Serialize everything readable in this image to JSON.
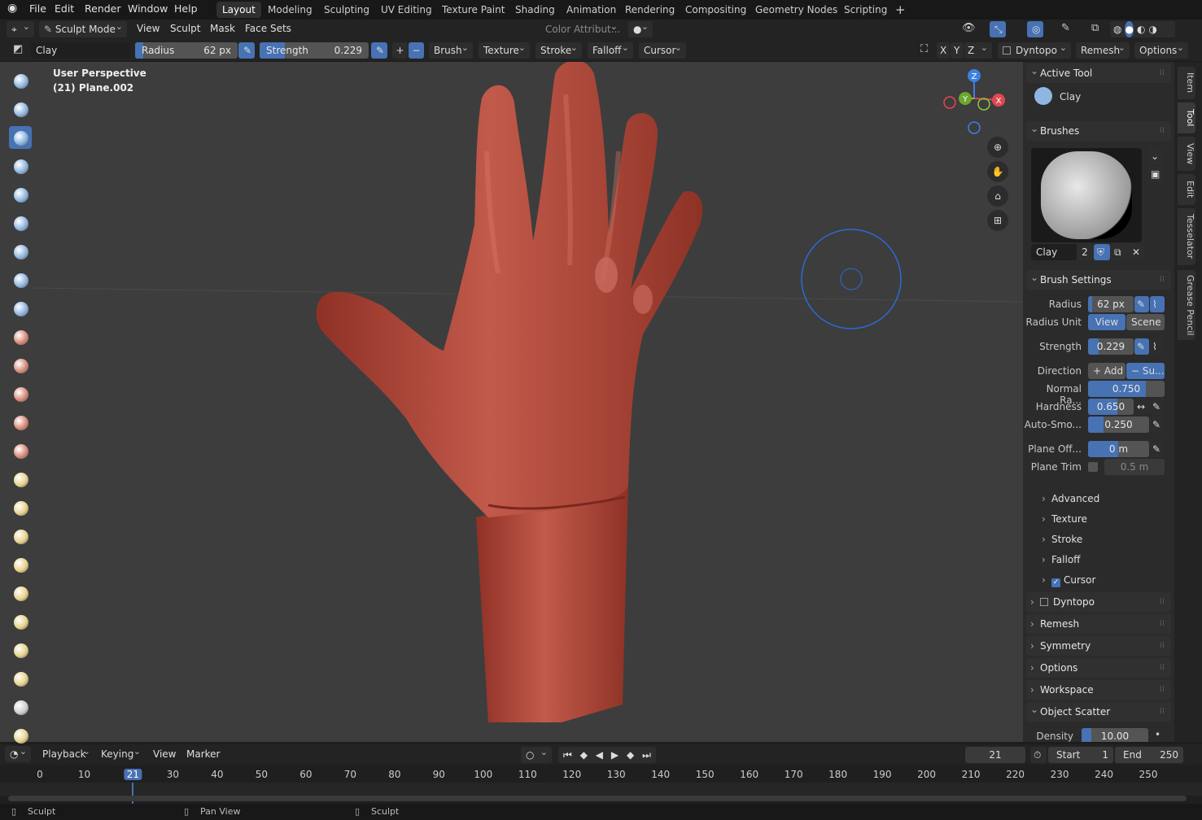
{
  "app": {
    "menus": [
      "File",
      "Edit",
      "Render",
      "Window",
      "Help"
    ],
    "workspaces": [
      "Layout",
      "Modeling",
      "Sculpting",
      "UV Editing",
      "Texture Paint",
      "Shading",
      "Animation",
      "Rendering",
      "Compositing",
      "Geometry Nodes",
      "Scripting"
    ],
    "active_workspace": "Layout",
    "add_tab": "+"
  },
  "header": {
    "mode": "Sculpt Mode",
    "menus": [
      "View",
      "Sculpt",
      "Mask",
      "Face Sets"
    ],
    "color_attr": "Color Attribut...",
    "axes": [
      "X",
      "Y",
      "Z"
    ],
    "dyntopo": "Dyntopo",
    "remesh": "Remesh",
    "options": "Options"
  },
  "tool_header": {
    "brush_name": "Clay",
    "radius_label": "Radius",
    "radius_value": "62 px",
    "strength_label": "Strength",
    "strength_value": "0.229",
    "strength_fraction": 0.229,
    "menus": [
      "Brush",
      "Texture",
      "Stroke",
      "Falloff",
      "Cursor"
    ],
    "plus": "+",
    "minus": "−"
  },
  "viewport": {
    "perspective": "User Perspective",
    "object": "(21) Plane.002",
    "gizmo": {
      "z": "Z",
      "y": "Y",
      "x": "X"
    }
  },
  "npanel": {
    "active_tool": {
      "title": "Active Tool",
      "name": "Clay"
    },
    "brushes": {
      "title": "Brushes",
      "name": "Clay",
      "users": "2"
    },
    "brush_settings": {
      "title": "Brush Settings",
      "radius": {
        "label": "Radius",
        "value": "62 px"
      },
      "radius_unit": {
        "label": "Radius Unit",
        "view": "View",
        "scene": "Scene"
      },
      "strength": {
        "label": "Strength",
        "value": "0.229",
        "fraction": 0.229
      },
      "direction": {
        "label": "Direction",
        "add": "+ Add",
        "sub": "− Su..."
      },
      "normal_radius": {
        "label": "Normal Ra...",
        "value": "0.750",
        "fraction": 0.75
      },
      "hardness": {
        "label": "Hardness",
        "value": "0.650",
        "fraction": 0.65
      },
      "auto_smooth": {
        "label": "Auto-Smo...",
        "value": "0.250",
        "fraction": 0.25
      },
      "plane_offset": {
        "label": "Plane Off...",
        "value": "0 m"
      },
      "plane_trim": {
        "label": "Plane Trim",
        "value": "0.5 m"
      }
    },
    "subpanels": [
      "Advanced",
      "Texture",
      "Stroke",
      "Falloff",
      "Cursor"
    ],
    "panels": [
      "Dyntopo",
      "Remesh",
      "Symmetry",
      "Options",
      "Workspace"
    ],
    "object_scatter": {
      "title": "Object Scatter",
      "density_label": "Density",
      "density_value": "10.00"
    }
  },
  "side_tabs": [
    "Item",
    "Tool",
    "View",
    "Edit",
    "Tesselator",
    "Grease Pencil"
  ],
  "timeline": {
    "menus": [
      "Playback",
      "Keying",
      "View",
      "Marker"
    ],
    "current_frame": "21",
    "start_label": "Start",
    "start": "1",
    "end_label": "End",
    "end": "250",
    "ticks": [
      "0",
      "10",
      "21",
      "30",
      "40",
      "50",
      "60",
      "70",
      "80",
      "90",
      "100",
      "110",
      "120",
      "130",
      "140",
      "150",
      "160",
      "170",
      "180",
      "190",
      "200",
      "210",
      "220",
      "230",
      "240",
      "250"
    ]
  },
  "status": {
    "left": "Sculpt",
    "middle": "Pan View",
    "right": "Sculpt"
  },
  "colors": {
    "accent": "#4772b3",
    "skin": "#b5483c",
    "bg": "#3d3d3d"
  }
}
